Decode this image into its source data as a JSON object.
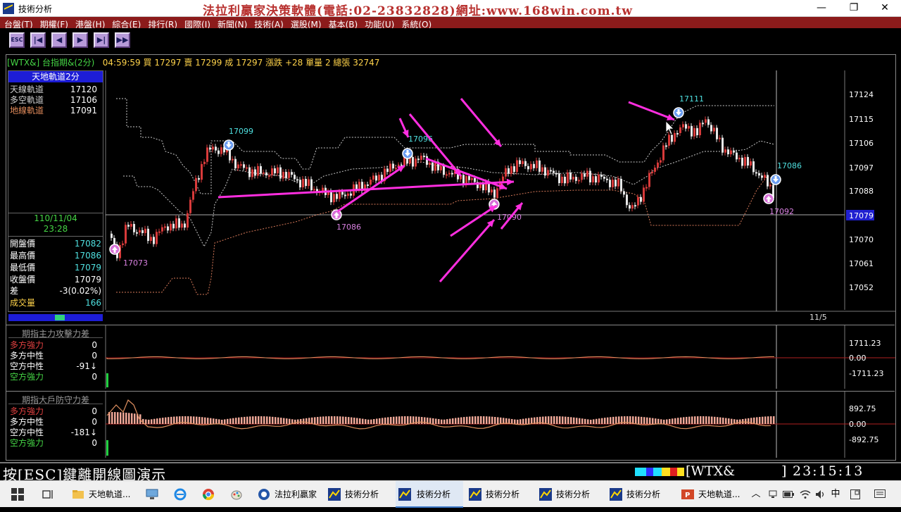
{
  "window": {
    "title": "技術分析",
    "banner": "法拉利贏家決策軟體(電話:02-23832828)網址:www.168win.com.tw",
    "controls": {
      "minimize": "—",
      "maximize": "❐",
      "close": "✕"
    }
  },
  "menu": [
    "台盤(T)",
    "期權(F)",
    "港盤(H)",
    "綜合(E)",
    "排行(R)",
    "國際(I)",
    "新聞(N)",
    "技術(A)",
    "選股(M)",
    "基本(B)",
    "功能(U)",
    "系統(O)"
  ],
  "toolbar": {
    "esc_label": "ESC",
    "first": "|◀",
    "prev": "◀",
    "next": "▶",
    "last": "▶|",
    "fast": "▶▶"
  },
  "quote": {
    "symbol": "[WTX&]",
    "name": "台指期&(2分)",
    "time": "04:59:59",
    "bid_label": "買",
    "bid": "17297",
    "ask_label": "賣",
    "ask": "17299",
    "last_label": "成",
    "last": "17297",
    "change_label": "漲跌",
    "change": "+28",
    "vol_label": "單量",
    "vol": "2",
    "total_label": "總張",
    "total": "32747"
  },
  "indicator": {
    "title": "天地軌道2分",
    "rows": [
      {
        "label": "天線軌道",
        "value": "17120",
        "color": "#d0d0d0"
      },
      {
        "label": "多空軌道",
        "value": "17106",
        "color": "#d0d0d0"
      },
      {
        "label": "地線軌道",
        "value": "17091",
        "color": "#e08a5a"
      }
    ]
  },
  "cursor": {
    "date": "110/11/04",
    "time": "23:28"
  },
  "ohlc": [
    {
      "label": "開盤價",
      "value": "17082",
      "lcolor": "#ffffff",
      "vcolor": "#4fe0e0"
    },
    {
      "label": "最高價",
      "value": "17086",
      "lcolor": "#ffffff",
      "vcolor": "#4fe0e0"
    },
    {
      "label": "最低價",
      "value": "17079",
      "lcolor": "#ffffff",
      "vcolor": "#4fe0e0"
    },
    {
      "label": "收盤價",
      "value": "17079",
      "lcolor": "#ffffff",
      "vcolor": "#ffffff"
    },
    {
      "label": "差",
      "value": "-3(0.02%)",
      "lcolor": "#ffffff",
      "vcolor": "#ffffff"
    },
    {
      "label": "成交量",
      "value": "166",
      "lcolor": "#ffd34a",
      "vcolor": "#4fe0e0"
    }
  ],
  "price_axis": [
    "17124",
    "17115",
    "17106",
    "17097",
    "17088",
    "17079",
    "17070",
    "17061",
    "17052"
  ],
  "current_price": "17079",
  "date_label": "11/5",
  "markers": [
    {
      "label": "17073",
      "kind": "low"
    },
    {
      "label": "17099",
      "kind": "high"
    },
    {
      "label": "17086",
      "kind": "low"
    },
    {
      "label": "17096",
      "kind": "high"
    },
    {
      "label": "17090",
      "kind": "low"
    },
    {
      "label": "17111",
      "kind": "high"
    },
    {
      "label": "17086",
      "kind": "high"
    },
    {
      "label": "17092",
      "kind": "low"
    }
  ],
  "panel1": {
    "title": "期指主力攻擊力差",
    "rows": [
      {
        "label": "多方強力",
        "value": "0",
        "color": "#e04040"
      },
      {
        "label": "多方中性",
        "value": "0",
        "color": "#ffffff"
      },
      {
        "label": "空方中性",
        "value": "-91↓",
        "color": "#ffffff"
      },
      {
        "label": "空方強力",
        "value": "0",
        "color": "#45d545"
      }
    ],
    "axis": [
      "1711.23",
      "0.00",
      "-1711.23"
    ]
  },
  "panel2": {
    "title": "期指大戶防守力差",
    "rows": [
      {
        "label": "多方強力",
        "value": "0",
        "color": "#e04040"
      },
      {
        "label": "多方中性",
        "value": "0",
        "color": "#ffffff"
      },
      {
        "label": "空方中性",
        "value": "-181↓",
        "color": "#ffffff"
      },
      {
        "label": "空方強力",
        "value": "0",
        "color": "#45d545"
      }
    ],
    "axis": [
      "892.75",
      "0.00",
      "-892.75"
    ]
  },
  "status": {
    "hint": "按[ESC]鍵離開線圖演示",
    "symbol": "[WTX&",
    "bracket": "]",
    "clock": "23:15:13"
  },
  "taskbar": {
    "items": [
      "天地軌道...",
      "法拉利贏家",
      "技術分析",
      "技術分析",
      "技術分析",
      "技術分析",
      "技術分析",
      "天地軌道..."
    ],
    "ime": "中"
  },
  "colors": {
    "up": "#d83a3a",
    "down": "#e8e8e8",
    "arrow": "#ff2ee0",
    "band": "#c8c8c8",
    "lowband": "#d87a5a"
  }
}
